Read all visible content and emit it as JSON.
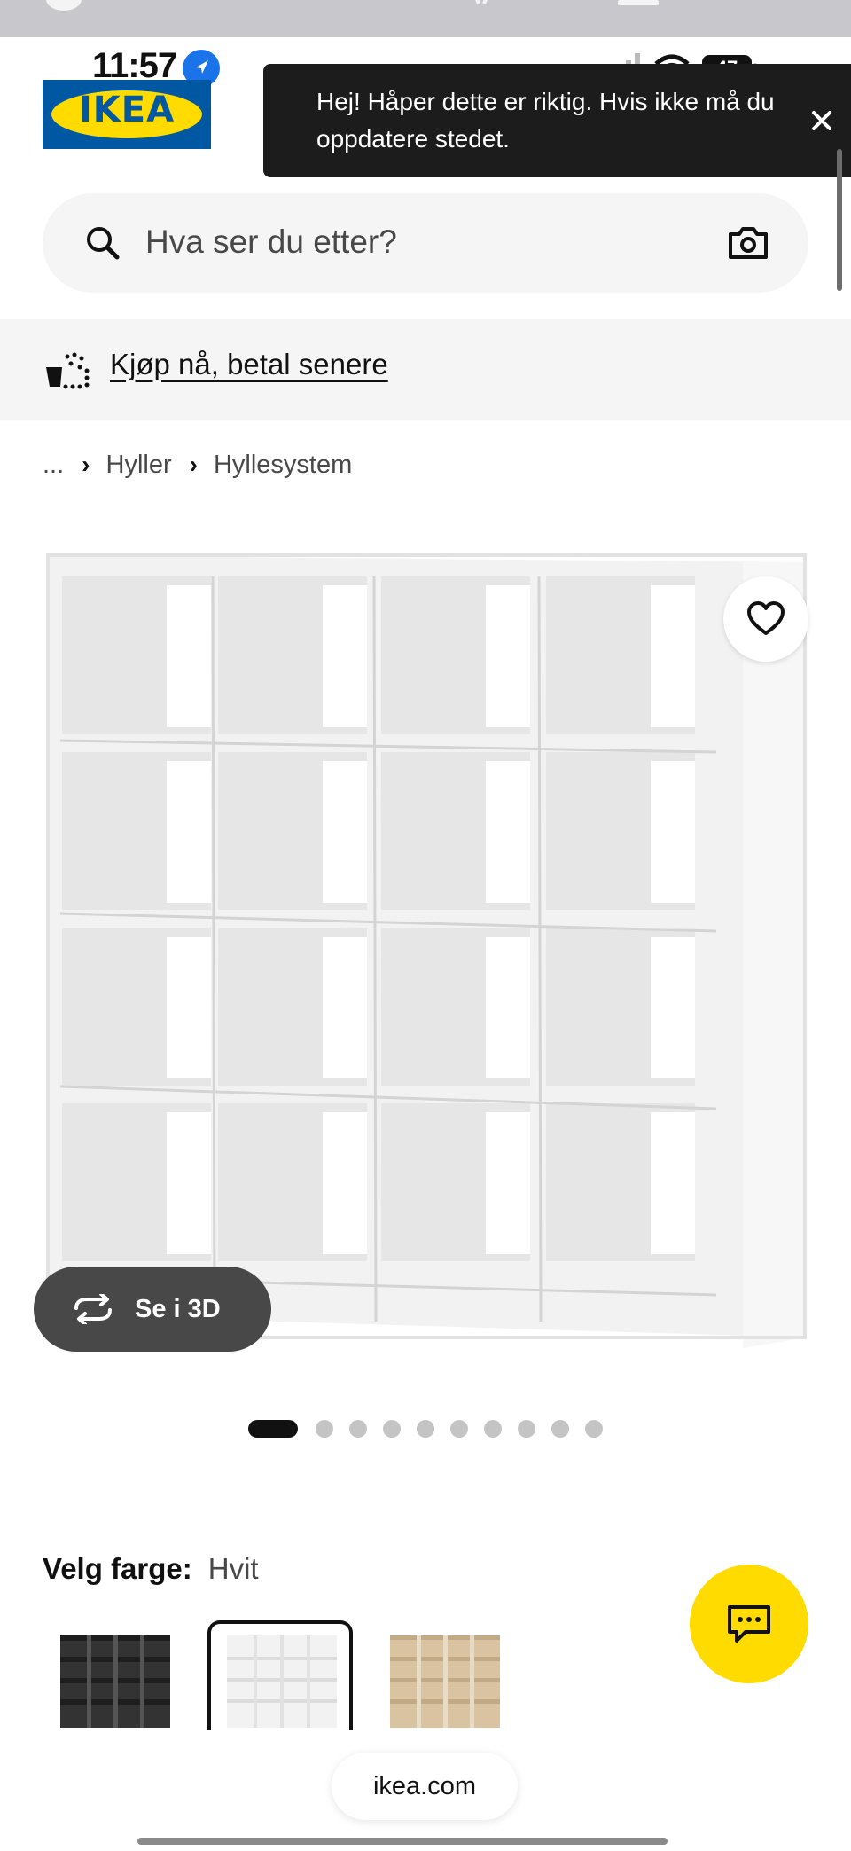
{
  "status_bar": {
    "time": "11:57",
    "battery": "47"
  },
  "header": {
    "logo_text": "IKEA"
  },
  "location_toast": {
    "message": "Hej! Håper dette er riktig. Hvis ikke må du oppdatere stedet.",
    "close_icon": "close-icon"
  },
  "search": {
    "placeholder": "Hva ser du etter?",
    "icons": [
      "search-icon",
      "camera-icon"
    ]
  },
  "promo_banner": {
    "text": "Kjøp nå, betal senere",
    "icon": "payment-icon"
  },
  "breadcrumb": {
    "items": [
      "...",
      "Hyller",
      "Hyllesystem"
    ]
  },
  "gallery": {
    "button_3d_label": "Se i 3D",
    "image_count": 10,
    "active_index": 0,
    "favourite_icon": "heart-icon"
  },
  "color_picker": {
    "label": "Velg farge:",
    "selected": "Hvit",
    "swatches": [
      {
        "name": "svart",
        "color": "#333333"
      },
      {
        "name": "hvit",
        "color": "#ffffff"
      },
      {
        "name": "eik",
        "color": "#d9c3a0"
      }
    ]
  },
  "chat": {
    "icon": "chat-icon",
    "color": "#ffdb00"
  },
  "browser": {
    "url": "ikea.com"
  },
  "colors": {
    "ikea_blue": "#0058a3",
    "ikea_yellow": "#ffdb00",
    "toast_bg": "#1c1c1c"
  }
}
